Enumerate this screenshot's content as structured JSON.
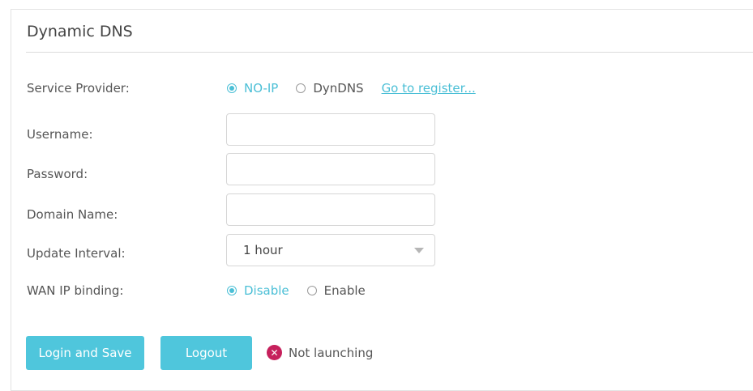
{
  "page": {
    "title": "Dynamic DNS"
  },
  "service_provider": {
    "label": "Service Provider:",
    "options": [
      "NO-IP",
      "DynDNS"
    ],
    "selected": "NO-IP",
    "register_link": "Go to register..."
  },
  "username": {
    "label": "Username:",
    "value": ""
  },
  "password": {
    "label": "Password:",
    "value": ""
  },
  "domain_name": {
    "label": "Domain Name:",
    "value": ""
  },
  "update_interval": {
    "label": "Update Interval:",
    "value": "1 hour"
  },
  "wan_ip_binding": {
    "label": "WAN IP binding:",
    "options": [
      "Disable",
      "Enable"
    ],
    "selected": "Disable"
  },
  "actions": {
    "login_save": "Login and Save",
    "logout": "Logout"
  },
  "status": {
    "text": "Not launching",
    "icon": "error-x-icon",
    "color": "#c6205c"
  },
  "colors": {
    "accent": "#4bbfd6",
    "button": "#4fc6dc"
  }
}
